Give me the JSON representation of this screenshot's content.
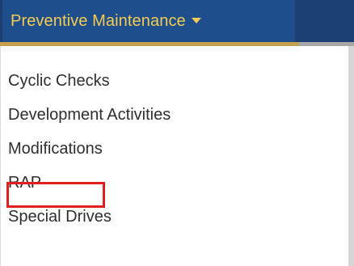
{
  "nav": {
    "label": "Preventive Maintenance",
    "caret_icon": "caret-down-icon",
    "colors": {
      "bar": "#1f4e8d",
      "text": "#f3cc52",
      "accent": "#c6a04d"
    }
  },
  "dropdown": {
    "items": [
      {
        "label": "Cyclic Checks"
      },
      {
        "label": "Development Activities"
      },
      {
        "label": "Modifications"
      },
      {
        "label": "RAP"
      },
      {
        "label": "Special Drives"
      }
    ],
    "highlighted_item": "RAP",
    "highlight_color": "#e02020"
  }
}
